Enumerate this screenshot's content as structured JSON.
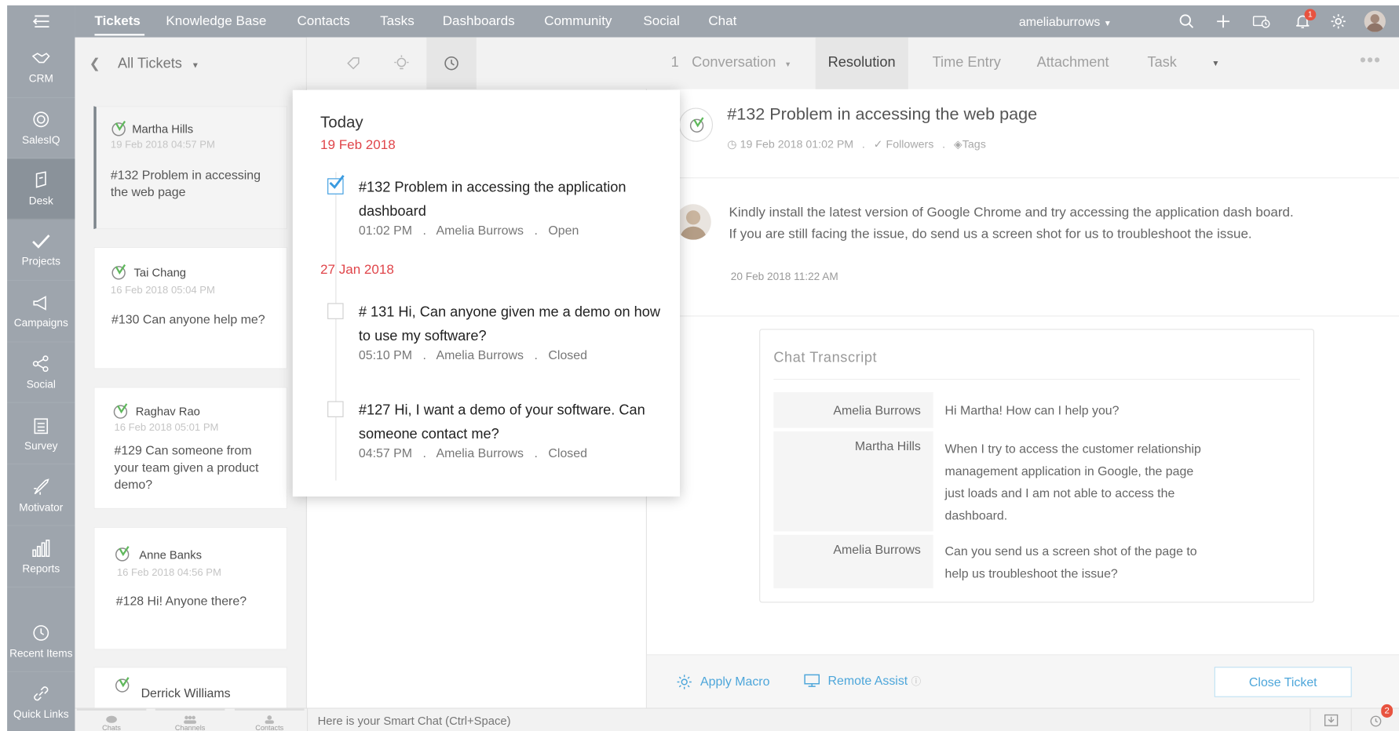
{
  "sidebar": {
    "items": [
      {
        "label": "CRM",
        "icon": "handshake-icon"
      },
      {
        "label": "SalesIQ",
        "icon": "target-icon"
      },
      {
        "label": "Desk",
        "icon": "desk-icon"
      },
      {
        "label": "Projects",
        "icon": "checkmark-icon"
      },
      {
        "label": "Campaigns",
        "icon": "megaphone-icon"
      },
      {
        "label": "Social",
        "icon": "share-icon"
      },
      {
        "label": "Survey",
        "icon": "clipboard-icon"
      },
      {
        "label": "Motivator",
        "icon": "rocket-icon"
      },
      {
        "label": "Reports",
        "icon": "bar-chart-icon"
      },
      {
        "label": "Recent Items",
        "icon": "history-icon"
      },
      {
        "label": "Quick Links",
        "icon": "link-icon"
      }
    ]
  },
  "topnav": {
    "items": [
      "Tickets",
      "Knowledge Base",
      "Contacts",
      "Tasks",
      "Dashboards",
      "Community",
      "Social",
      "Chat"
    ],
    "user": "ameliaburrows",
    "notification_count": "1"
  },
  "ticket_list": {
    "view_label": "All Tickets",
    "tickets": [
      {
        "name": "Martha Hills",
        "date": "19 Feb 2018 04:57 PM",
        "title": "#132  Problem in accessing the web page"
      },
      {
        "name": "Tai Chang",
        "date": "16 Feb 2018 05:04 PM",
        "title": "#130 Can anyone help me?"
      },
      {
        "name": "Raghav Rao",
        "date": "16 Feb 2018 05:01 PM",
        "title": "#129  Can someone from your team given a product demo?"
      },
      {
        "name": "Anne Banks",
        "date": "16 Feb 2018 04:56 PM",
        "title": "#128  Hi! Anyone there?"
      },
      {
        "name": "Derrick Williams",
        "date": "",
        "title": ""
      }
    ]
  },
  "history_popup": {
    "heading": "Today",
    "groups": [
      {
        "date": "19 Feb 2018",
        "items": [
          {
            "title": "#132 Problem in accessing the application dashboard",
            "time": "01:02 PM",
            "agent": "Amelia Burrows",
            "status": "Open",
            "checked": true
          }
        ]
      },
      {
        "date": "27 Jan 2018",
        "items": [
          {
            "title": "# 131 Hi, Can anyone given me a demo on how to use my software?",
            "time": "05:10 PM",
            "agent": "Amelia Burrows",
            "status": "Closed",
            "checked": false
          },
          {
            "title": "#127 Hi, I want a demo of your software. Can someone contact me?",
            "time": "04:57 PM",
            "agent": "Amelia Burrows",
            "status": "Closed",
            "checked": false
          }
        ]
      }
    ]
  },
  "detail": {
    "tabs": {
      "conversation_count": "1",
      "conversation": "Conversation",
      "resolution": "Resolution",
      "time_entry": "Time Entry",
      "attachment": "Attachment",
      "task": "Task"
    },
    "ticket_title": "#132  Problem in accessing the web page",
    "ticket_date": "19 Feb 2018 01:02 PM",
    "followers": "Followers",
    "tags": "Tags",
    "resolution_text": "Kindly install the latest version of Google Chrome and try accessing the application dash board. If you are still facing the issue, do send us a screen shot for us to troubleshoot the issue.",
    "resolution_date": "20 Feb 2018 11:22 AM",
    "transcript": {
      "title": "Chat Transcript",
      "rows": [
        {
          "who": "Amelia Burrows",
          "msg": "Hi Martha! How can I help you?"
        },
        {
          "who": "Martha Hills",
          "msg": "When I try to access the customer relationship management application in Google, the page just loads and I am not able to access the dashboard."
        },
        {
          "who": "Amelia Burrows",
          "msg": "Can you send us a screen shot of the page to help us troubleshoot the issue?"
        }
      ]
    },
    "actions": {
      "apply_macro": "Apply Macro",
      "remote_assist": "Remote Assist",
      "close_ticket": "Close Ticket"
    }
  },
  "bottombar": {
    "tabs": [
      "Chats",
      "Channels",
      "Contacts"
    ],
    "smart_chat_placeholder": "Here is your Smart Chat (Ctrl+Space)",
    "alarm_count": "2"
  },
  "colors": {
    "nav_bg": "#9ea5ad",
    "accent_red": "#e0454a",
    "accent_blue": "#4da6da",
    "checkbox_blue": "#3a9be0",
    "ticket_icon_green": "#5fb85c"
  }
}
